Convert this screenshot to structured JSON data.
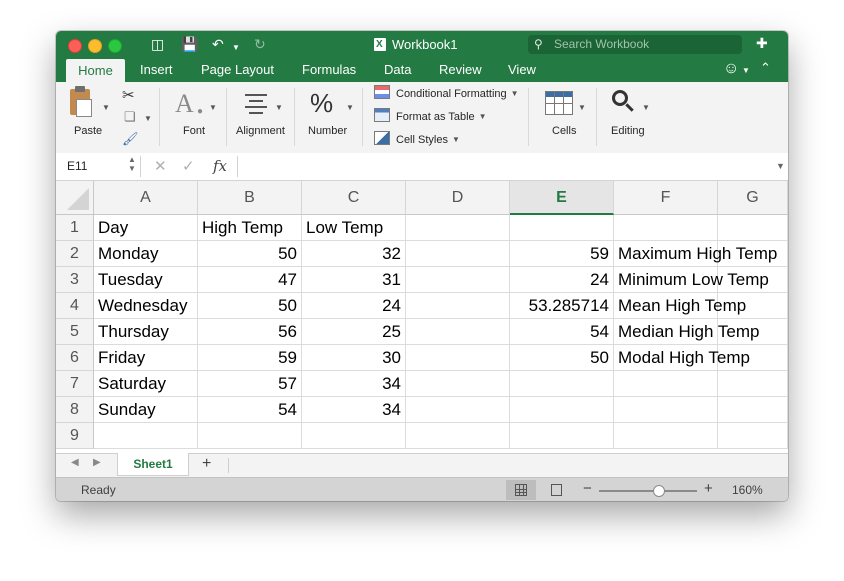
{
  "window": {
    "title": "Workbook1",
    "search_placeholder": "Search Workbook"
  },
  "ribbon_tabs": [
    "Home",
    "Insert",
    "Page Layout",
    "Formulas",
    "Data",
    "Review",
    "View"
  ],
  "ribbon": {
    "paste": "Paste",
    "font": "Font",
    "alignment": "Alignment",
    "number": "Number",
    "conditional_formatting": "Conditional Formatting",
    "format_as_table": "Format as Table",
    "cell_styles": "Cell Styles",
    "cells": "Cells",
    "editing": "Editing"
  },
  "formula_bar": {
    "name_box": "E11",
    "formula": ""
  },
  "sheet": {
    "columns": [
      "A",
      "B",
      "C",
      "D",
      "E",
      "F",
      "G"
    ],
    "selected_column": "E",
    "rows": [
      {
        "n": "1",
        "A": "Day",
        "B": "High Temp",
        "C": "Low Temp",
        "E": "",
        "F": ""
      },
      {
        "n": "2",
        "A": "Monday",
        "B": "50",
        "C": "32",
        "E": "59",
        "F": "Maximum High Temp"
      },
      {
        "n": "3",
        "A": "Tuesday",
        "B": "47",
        "C": "31",
        "E": "24",
        "F": "Minimum Low Temp"
      },
      {
        "n": "4",
        "A": "Wednesday",
        "B": "50",
        "C": "24",
        "E": "53.285714",
        "F": "Mean High Temp"
      },
      {
        "n": "5",
        "A": "Thursday",
        "B": "56",
        "C": "25",
        "E": "54",
        "F": "Median High Temp"
      },
      {
        "n": "6",
        "A": "Friday",
        "B": "59",
        "C": "30",
        "E": "50",
        "F": "Modal High Temp"
      },
      {
        "n": "7",
        "A": "Saturday",
        "B": "57",
        "C": "34",
        "E": "",
        "F": ""
      },
      {
        "n": "8",
        "A": "Sunday",
        "B": "54",
        "C": "34",
        "E": "",
        "F": ""
      },
      {
        "n": "9",
        "A": "",
        "B": "",
        "C": "",
        "E": "",
        "F": ""
      }
    ]
  },
  "sheet_tabs": {
    "active": "Sheet1",
    "add": "+"
  },
  "status": {
    "text": "Ready",
    "zoom": "160%",
    "zoom_level": 0.6
  },
  "colors": {
    "accent": "#237a43",
    "titlebar": "#237a43"
  }
}
